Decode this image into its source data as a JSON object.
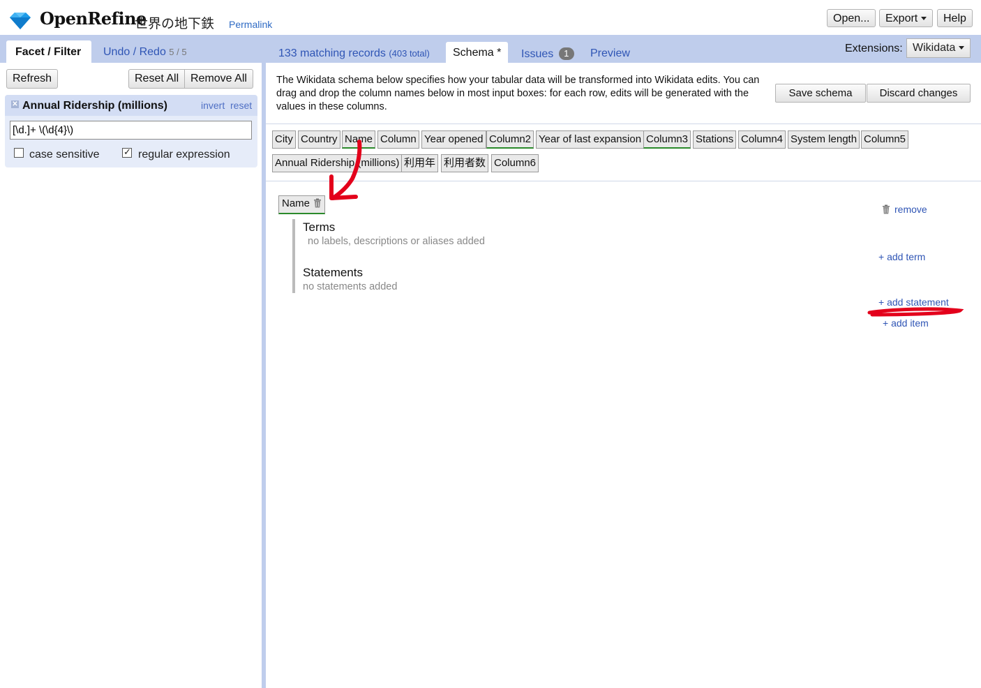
{
  "header": {
    "app_name": "OpenRefine",
    "project_name": "世界の地下鉄",
    "permalink": "Permalink",
    "buttons": {
      "open": "Open...",
      "export": "Export",
      "help": "Help"
    }
  },
  "left_panel": {
    "tabs": {
      "facet_filter": "Facet / Filter",
      "undo_redo": "Undo / Redo",
      "undo_count": "5 / 5"
    },
    "buttons": {
      "refresh": "Refresh",
      "reset_all": "Reset All",
      "remove_all": "Remove All"
    },
    "facet": {
      "close": "✕",
      "title": "Annual Ridership (millions)",
      "invert": "invert",
      "reset": "reset",
      "query": "[\\d.]+ \\(\\d{4}\\)",
      "case_sensitive_label": "case sensitive",
      "case_sensitive_checked": false,
      "regex_label": "regular expression",
      "regex_checked": true
    }
  },
  "right_panel": {
    "records_text": "133 matching records",
    "records_total": "(403 total)",
    "tabs": {
      "schema": "Schema *",
      "issues": "Issues",
      "issues_count": "1",
      "preview": "Preview"
    },
    "extensions_label": "Extensions:",
    "extensions_value": "Wikidata",
    "description": "The Wikidata schema below specifies how your tabular data will be transformed into Wikidata edits. You can drag and drop the column names below in most input boxes: for each row, edits will be generated with the values in these columns.",
    "buttons": {
      "save_schema": "Save schema",
      "discard_changes": "Discard changes"
    },
    "columns": [
      "City",
      "Country",
      "Name",
      "Column",
      "Year opened",
      "Column2",
      "Year of last expansion",
      "Column3",
      "Stations",
      "Column4",
      "System length",
      "Column5",
      "Annual Ridership (millions)",
      "利用年",
      "利用者数",
      "Column6"
    ],
    "used_columns": [
      "Name",
      "Column2",
      "Column3"
    ],
    "item": {
      "subject": "Name",
      "remove": "remove",
      "terms_title": "Terms",
      "terms_empty": "no labels, descriptions or aliases added",
      "add_term": "+ add term",
      "statements_title": "Statements",
      "statements_empty": "no statements added",
      "add_statement": "+ add statement"
    },
    "add_item": "+ add item"
  },
  "colors": {
    "tab_bar": "#bfcdec",
    "link": "#2f55b5",
    "used_column_underline": "#2b8a2b",
    "annotation": "#e3001b"
  }
}
